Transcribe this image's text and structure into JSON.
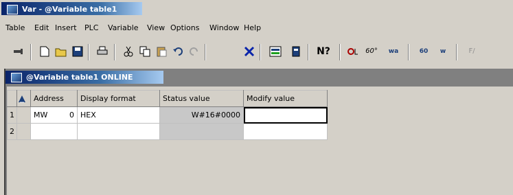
{
  "window": {
    "title": "Var - @Variable table1"
  },
  "menu": [
    "Table",
    "Edit",
    "Insert",
    "PLC",
    "Variable",
    "View",
    "Options",
    "Window",
    "Help"
  ],
  "toolbar": {
    "icons": [
      "pin-icon",
      "new-icon",
      "open-icon",
      "save-icon",
      "print-icon",
      "cut-icon",
      "copy-icon",
      "paste-icon",
      "undo-icon",
      "redo-icon",
      "delete-icon",
      "monitor-icon",
      "modify-icon",
      "help-icon",
      "trigger-icon",
      "monitor-var-icon",
      "monitor-once-icon",
      "modify-once-icon",
      "modify-var-icon",
      "force-icon"
    ],
    "force_label": "F/"
  },
  "child": {
    "title": "@Variable table1  ONLINE"
  },
  "table": {
    "headers": [
      "Address",
      "Display format",
      "Status value",
      "Modify value"
    ],
    "rows": [
      {
        "num": "1",
        "address": "MW",
        "address_index": "0",
        "format": "HEX",
        "status": "W#16#0000",
        "modify": ""
      },
      {
        "num": "2",
        "address": "",
        "address_index": "",
        "format": "",
        "status": "",
        "modify": ""
      }
    ]
  }
}
